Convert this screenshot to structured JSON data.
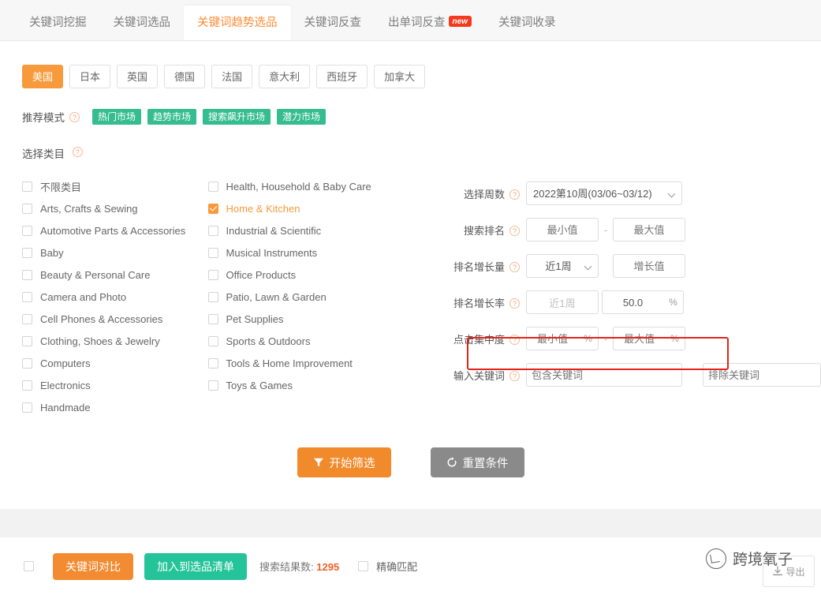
{
  "tabs": [
    {
      "label": "关键词挖掘",
      "active": false,
      "badge": ""
    },
    {
      "label": "关键词选品",
      "active": false,
      "badge": ""
    },
    {
      "label": "关键词趋势选品",
      "active": true,
      "badge": ""
    },
    {
      "label": "关键词反查",
      "active": false,
      "badge": ""
    },
    {
      "label": "出单词反查",
      "active": false,
      "badge": "new"
    },
    {
      "label": "关键词收录",
      "active": false,
      "badge": ""
    }
  ],
  "countries": [
    {
      "label": "美国",
      "active": true
    },
    {
      "label": "日本",
      "active": false
    },
    {
      "label": "英国",
      "active": false
    },
    {
      "label": "德国",
      "active": false
    },
    {
      "label": "法国",
      "active": false
    },
    {
      "label": "意大利",
      "active": false
    },
    {
      "label": "西班牙",
      "active": false
    },
    {
      "label": "加拿大",
      "active": false
    }
  ],
  "recommend": {
    "label": "推荐模式",
    "help": "?",
    "tags": [
      "热门市场",
      "趋势市场",
      "搜索飙升市场",
      "潜力市场"
    ]
  },
  "category": {
    "label": "选择类目",
    "help": "?",
    "column1": [
      {
        "label": "不限类目",
        "checked": false
      },
      {
        "label": "Arts, Crafts & Sewing",
        "checked": false
      },
      {
        "label": "Automotive Parts & Accessories",
        "checked": false
      },
      {
        "label": "Baby",
        "checked": false
      },
      {
        "label": "Beauty & Personal Care",
        "checked": false
      },
      {
        "label": "Camera and Photo",
        "checked": false
      },
      {
        "label": "Cell Phones & Accessories",
        "checked": false
      },
      {
        "label": "Clothing, Shoes & Jewelry",
        "checked": false
      },
      {
        "label": "Computers",
        "checked": false
      },
      {
        "label": "Electronics",
        "checked": false
      },
      {
        "label": "Handmade",
        "checked": false
      }
    ],
    "column2": [
      {
        "label": "Health, Household & Baby Care",
        "checked": false
      },
      {
        "label": "Home & Kitchen",
        "checked": true
      },
      {
        "label": "Industrial & Scientific",
        "checked": false
      },
      {
        "label": "Musical Instruments",
        "checked": false
      },
      {
        "label": "Office Products",
        "checked": false
      },
      {
        "label": "Patio, Lawn & Garden",
        "checked": false
      },
      {
        "label": "Pet Supplies",
        "checked": false
      },
      {
        "label": "Sports & Outdoors",
        "checked": false
      },
      {
        "label": "Tools & Home Improvement",
        "checked": false
      },
      {
        "label": "Toys & Games",
        "checked": false
      }
    ]
  },
  "filters": {
    "week": {
      "label": "选择周数",
      "help": "?",
      "selected": "2022第10周(03/06~03/12)"
    },
    "search_rank": {
      "label": "搜索排名",
      "help": "?",
      "min_placeholder": "最小值",
      "max_placeholder": "最大值",
      "separator": "-"
    },
    "rank_growth": {
      "label": "排名增长量",
      "help": "?",
      "period": "近1周",
      "value_placeholder": "增长值"
    },
    "rank_growth_rate": {
      "label": "排名增长率",
      "help": "?",
      "period": "近1周",
      "value": "50.0",
      "unit": "%"
    },
    "click_concentration": {
      "label": "点击集中度",
      "help": "?",
      "min_placeholder": "最小值",
      "max_placeholder": "最大值",
      "unit": "%",
      "separator": "-"
    },
    "keywords": {
      "label": "输入关键词",
      "help": "?",
      "include_placeholder": "包含关键词",
      "exclude_placeholder": "排除关键词"
    }
  },
  "actions": {
    "start_filter": "开始筛选",
    "reset": "重置条件"
  },
  "bottom": {
    "compare": "关键词对比",
    "add_to_list": "加入到选品清单",
    "result_prefix": "搜索结果数:",
    "result_count": "1295",
    "exact_match": "精确匹配",
    "export": "导出"
  },
  "watermark": {
    "text": "跨境氧子"
  },
  "colors": {
    "accent_orange": "#f79a3c",
    "tag_green": "#35bd8f",
    "teal": "#25c39a",
    "highlight_red": "#e22418",
    "count_red": "#f0612a"
  }
}
